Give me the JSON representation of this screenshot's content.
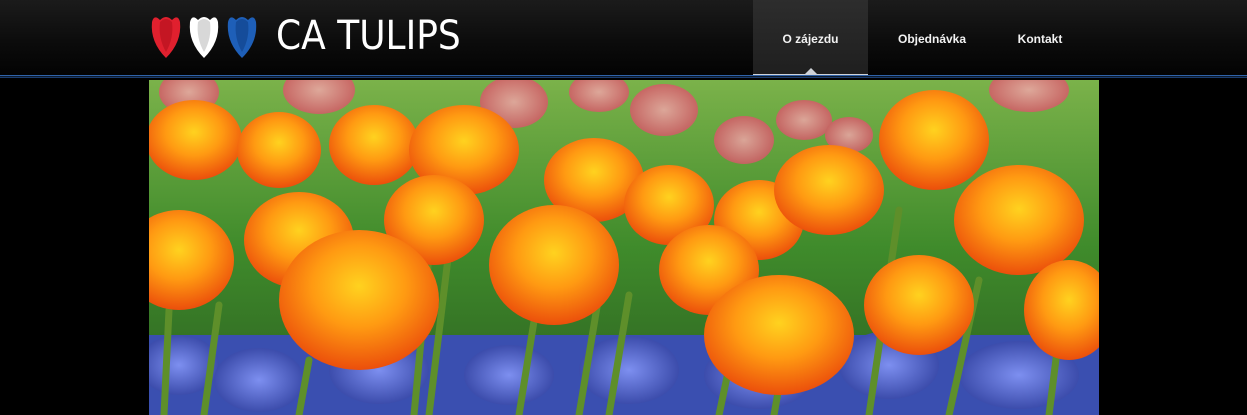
{
  "site": {
    "name": "CA TULIPS",
    "logo_colors": [
      "#e0202e",
      "#ffffff",
      "#1e5fb8"
    ]
  },
  "nav": {
    "items": [
      {
        "label": "O zájezdu",
        "active": true
      },
      {
        "label": "Objednávka",
        "active": false
      },
      {
        "label": "Kontakt",
        "active": false
      }
    ]
  },
  "hero": {
    "icon": "tulip-field-photo",
    "colors": {
      "tulips": "#f26a0c",
      "background_tulips": "#e8647a",
      "grape_hyacinths": "#4a64c8",
      "foliage": "#3f8b2b"
    }
  }
}
